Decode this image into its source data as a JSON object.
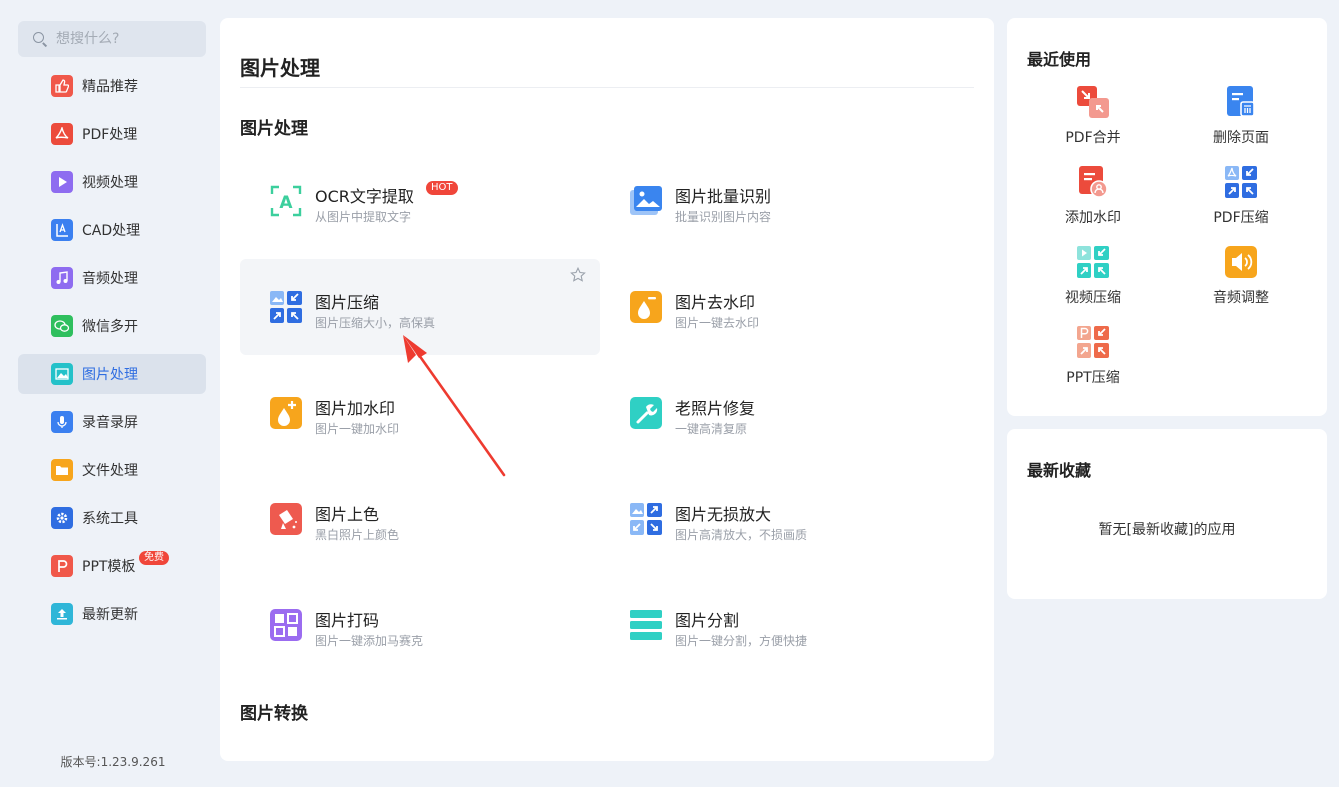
{
  "search": {
    "placeholder": "想搜什么?"
  },
  "sidebar": {
    "items": [
      {
        "label": "精品推荐",
        "icon": "thumbs-up-icon",
        "color": "#f0584a"
      },
      {
        "label": "PDF处理",
        "icon": "pdf-icon",
        "color": "#ec4b3c"
      },
      {
        "label": "视频处理",
        "icon": "play-icon",
        "color": "#8e6cf0"
      },
      {
        "label": "CAD处理",
        "icon": "cad-icon",
        "color": "#3b80f0"
      },
      {
        "label": "音频处理",
        "icon": "music-icon",
        "color": "#8e6cf0"
      },
      {
        "label": "微信多开",
        "icon": "wechat-icon",
        "color": "#2fbf5e"
      },
      {
        "label": "图片处理",
        "icon": "image-icon",
        "color": "#24c1c9"
      },
      {
        "label": "录音录屏",
        "icon": "microphone-icon",
        "color": "#3b80f0"
      },
      {
        "label": "文件处理",
        "icon": "folder-icon",
        "color": "#f7a51c"
      },
      {
        "label": "系统工具",
        "icon": "gear-icon",
        "color": "#2f6de1"
      },
      {
        "label": "PPT模板",
        "icon": "ppt-icon",
        "color": "#f0584a"
      },
      {
        "label": "最新更新",
        "icon": "upload-icon",
        "color": "#2fb6d8"
      }
    ],
    "free_badge": "免费",
    "version": "版本号:1.23.9.261"
  },
  "main": {
    "title": "图片处理",
    "section1": "图片处理",
    "section2": "图片转换",
    "hot_badge": "HOT",
    "tools": [
      {
        "name": "OCR文字提取",
        "desc": "从图片中提取文字",
        "icon": "ocr-icon"
      },
      {
        "name": "图片批量识别",
        "desc": "批量识别图片内容",
        "icon": "batch-image-icon"
      },
      {
        "name": "图片压缩",
        "desc": "图片压缩大小，高保真",
        "icon": "compress-icon"
      },
      {
        "name": "图片去水印",
        "desc": "图片一键去水印",
        "icon": "remove-watermark-icon"
      },
      {
        "name": "图片加水印",
        "desc": "图片一键加水印",
        "icon": "add-watermark-icon"
      },
      {
        "name": "老照片修复",
        "desc": "一键高清复原",
        "icon": "photo-repair-icon"
      },
      {
        "name": "图片上色",
        "desc": "黑白照片上颜色",
        "icon": "colorize-icon"
      },
      {
        "name": "图片无损放大",
        "desc": "图片高清放大，不损画质",
        "icon": "upscale-icon"
      },
      {
        "name": "图片打码",
        "desc": "图片一键添加马赛克",
        "icon": "mosaic-icon"
      },
      {
        "name": "图片分割",
        "desc": "图片一键分割，方便快捷",
        "icon": "split-icon"
      }
    ]
  },
  "recent": {
    "title": "最近使用",
    "items": [
      {
        "label": "PDF合并",
        "icon": "pdf-merge-icon"
      },
      {
        "label": "删除页面",
        "icon": "delete-page-icon"
      },
      {
        "label": "添加水印",
        "icon": "add-watermark-doc-icon"
      },
      {
        "label": "PDF压缩",
        "icon": "pdf-compress-icon"
      },
      {
        "label": "视频压缩",
        "icon": "video-compress-icon"
      },
      {
        "label": "音频调整",
        "icon": "audio-adjust-icon"
      },
      {
        "label": "PPT压缩",
        "icon": "ppt-compress-icon"
      }
    ]
  },
  "favorites": {
    "title": "最新收藏",
    "empty_text": "暂无[最新收藏]的应用"
  }
}
